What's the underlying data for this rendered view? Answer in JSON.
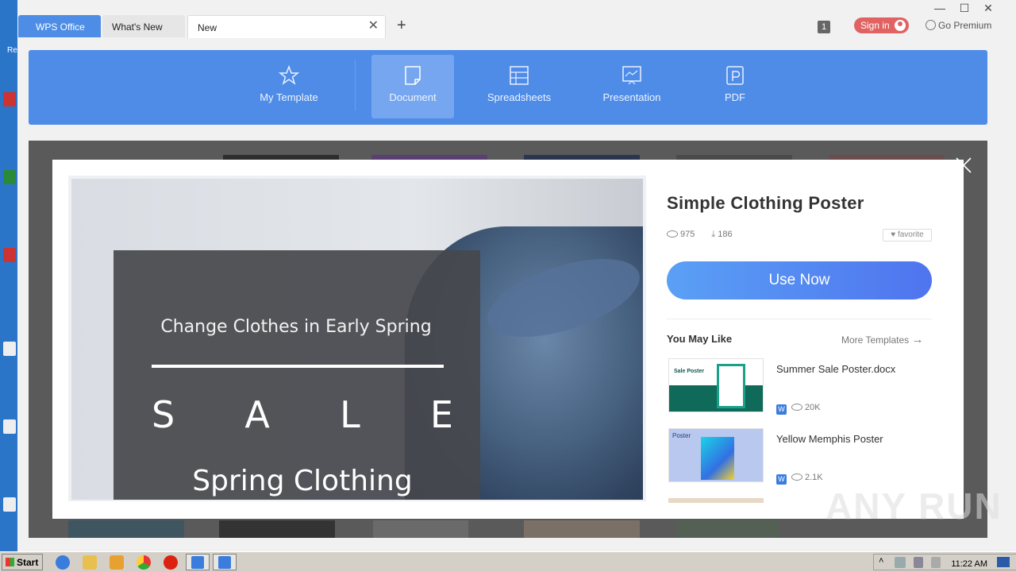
{
  "desktop": {
    "icon_text": "Re"
  },
  "tabs": [
    {
      "label": "WPS Office"
    },
    {
      "label": "What's New"
    },
    {
      "label": "New"
    }
  ],
  "titlebar": {
    "window_count": "1",
    "signin_label": "Sign in",
    "premium_label": "Go Premium",
    "add_tab_icon": "plus-icon",
    "close_tab_icon": "close-icon"
  },
  "nav": {
    "items": [
      {
        "label": "My Template",
        "icon": "star-icon"
      },
      {
        "label": "Document",
        "icon": "document-icon",
        "active": true
      },
      {
        "label": "Spreadsheets",
        "icon": "spreadsheet-icon"
      },
      {
        "label": "Presentation",
        "icon": "presentation-icon"
      },
      {
        "label": "PDF",
        "icon": "pdf-icon"
      }
    ]
  },
  "preview": {
    "poster_subtitle": "Change Clothes in Early Spring",
    "poster_sale_letters": [
      "S",
      "A",
      "L",
      "E"
    ],
    "poster_title": "Spring Clothing"
  },
  "detail": {
    "title": "Simple Clothing Poster",
    "views": "975",
    "downloads": "186",
    "favorite_label": "favorite",
    "use_now_label": "Use Now",
    "you_may_like_label": "You May Like",
    "more_templates_label": "More Templates"
  },
  "recommendations": [
    {
      "name": "Summer Sale Poster.docx",
      "views": "20K",
      "thumb_title": "Sale Poster"
    },
    {
      "name": "Yellow Memphis Poster",
      "views": "2.1K",
      "thumb_title": "Poster"
    }
  ],
  "watermark": "ANY RUN",
  "taskbar": {
    "start_label": "Start",
    "clock": "11:22 AM"
  },
  "colors": {
    "accent": "#4e8ce8",
    "signin": "#e06262",
    "use_now_from": "#5aa0f5",
    "use_now_to": "#4f74ef"
  }
}
